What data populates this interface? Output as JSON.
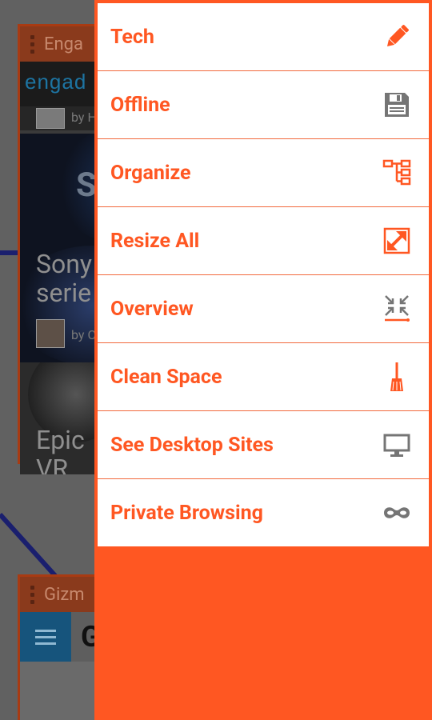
{
  "colors": {
    "accent": "#ff5722",
    "icon_gray": "#757575"
  },
  "background": {
    "card1": {
      "title": "Enga",
      "logo_text": "engad",
      "author_1": "by H",
      "headline": "Sony",
      "headline_line2": "serie",
      "author_2": "by C",
      "headline_2": "Epic",
      "headline_2_line2": "VR"
    },
    "card2": {
      "title": "Gizm",
      "logo_letter": "G"
    }
  },
  "menu": {
    "items": [
      {
        "label": "Tech",
        "icon": "pencil-icon"
      },
      {
        "label": "Offline",
        "icon": "floppy-disk-icon"
      },
      {
        "label": "Organize",
        "icon": "tree-structure-icon"
      },
      {
        "label": "Resize All",
        "icon": "expand-arrows-icon"
      },
      {
        "label": "Overview",
        "icon": "collapse-arrows-icon"
      },
      {
        "label": "Clean Space",
        "icon": "broom-icon"
      },
      {
        "label": "See Desktop Sites",
        "icon": "monitor-icon"
      },
      {
        "label": "Private Browsing",
        "icon": "mask-icon"
      }
    ]
  }
}
